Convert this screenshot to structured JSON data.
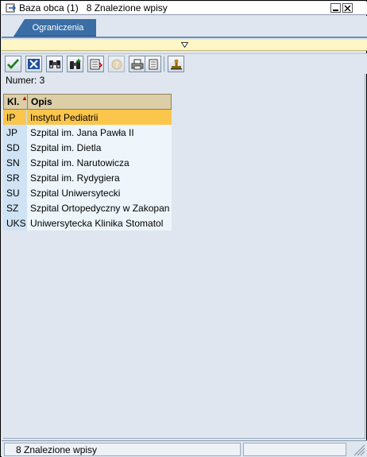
{
  "window": {
    "title": "Baza obca (1)   8 Znalezione wpisy",
    "minimize_icon": "minimize-icon",
    "close_icon": "close-icon"
  },
  "tabs": [
    {
      "label": "Ograniczenia"
    }
  ],
  "toolbar": {
    "buttons": [
      {
        "name": "confirm-button",
        "icon": "checkmark-icon",
        "color": "#1d7a1d"
      },
      {
        "name": "cancel-button",
        "icon": "x-icon",
        "color": "#1f4fa3"
      },
      {
        "name": "find-button",
        "icon": "binoculars-icon"
      },
      {
        "name": "find-next-button",
        "icon": "binoculars-plus-icon"
      },
      {
        "name": "sort-button",
        "icon": "sort-icon"
      },
      {
        "name": "info-button",
        "icon": "info-icon",
        "disabled": true
      },
      {
        "name": "print-button",
        "icon": "printer-icon"
      },
      {
        "name": "list-button",
        "icon": "document-list-icon"
      },
      {
        "name": "settings-button",
        "icon": "stamp-icon"
      }
    ]
  },
  "results": {
    "count_label": "Numer: 3"
  },
  "grid": {
    "columns": [
      "Kl.",
      "Opis"
    ],
    "rows": [
      {
        "key": "IP",
        "desc": "Instytut Pediatrii",
        "selected": true
      },
      {
        "key": "JP",
        "desc": "Szpital im. Jana Pawła II"
      },
      {
        "key": "SD",
        "desc": "Szpital im. Dietla"
      },
      {
        "key": "SN",
        "desc": "Szpital im. Narutowicza"
      },
      {
        "key": "SR",
        "desc": "Szpital im. Rydygiera"
      },
      {
        "key": "SU",
        "desc": "Szpital Uniwersytecki"
      },
      {
        "key": "SZ",
        "desc": "Szpital Ortopedyczny w Zakopan"
      },
      {
        "key": "UKS",
        "desc": "Uniwersytecka Klinika Stomatol"
      }
    ]
  },
  "status": {
    "message": "8 Znalezione wpisy"
  },
  "colors": {
    "tab_active": "#3a6ea5",
    "selected_row": "#fbc64b",
    "key_column": "#cfe3f4",
    "desc_column": "#eef6fc",
    "header": "#dccfa8"
  }
}
